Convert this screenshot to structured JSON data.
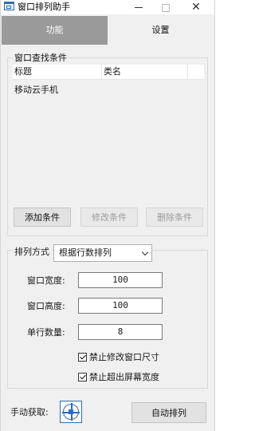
{
  "window": {
    "title": "窗口排列助手",
    "controls": {
      "minimize": "minimize-icon",
      "maximize": "maximize-icon",
      "close": "✕"
    }
  },
  "tabs": [
    {
      "label": "功能",
      "active": true
    },
    {
      "label": "设置",
      "active": false
    }
  ],
  "search_group": {
    "legend": "窗口查找条件",
    "columns": [
      "标题",
      "类名"
    ],
    "rows": [
      {
        "title": "移动云手机",
        "class": ""
      }
    ],
    "buttons": {
      "add": "添加条件",
      "modify": "修改条件",
      "delete": "删除条件"
    }
  },
  "arrange_group": {
    "mode_label": "排列方式",
    "mode_value": "根据行数排列",
    "width_label": "窗口宽度:",
    "width_value": "100",
    "height_label": "窗口高度:",
    "height_value": "100",
    "per_row_label": "单行数量:",
    "per_row_value": "8",
    "checkbox_no_resize": {
      "label": "禁止修改窗口尺寸",
      "checked": true
    },
    "checkbox_no_overflow": {
      "label": "禁止超出屏幕宽度",
      "checked": true
    }
  },
  "footer": {
    "manual_label": "手动获取:",
    "auto_button": "自动排列"
  },
  "colors": {
    "active_tab_bg": "#9a9a9a",
    "accent": "#2c6cc0"
  }
}
